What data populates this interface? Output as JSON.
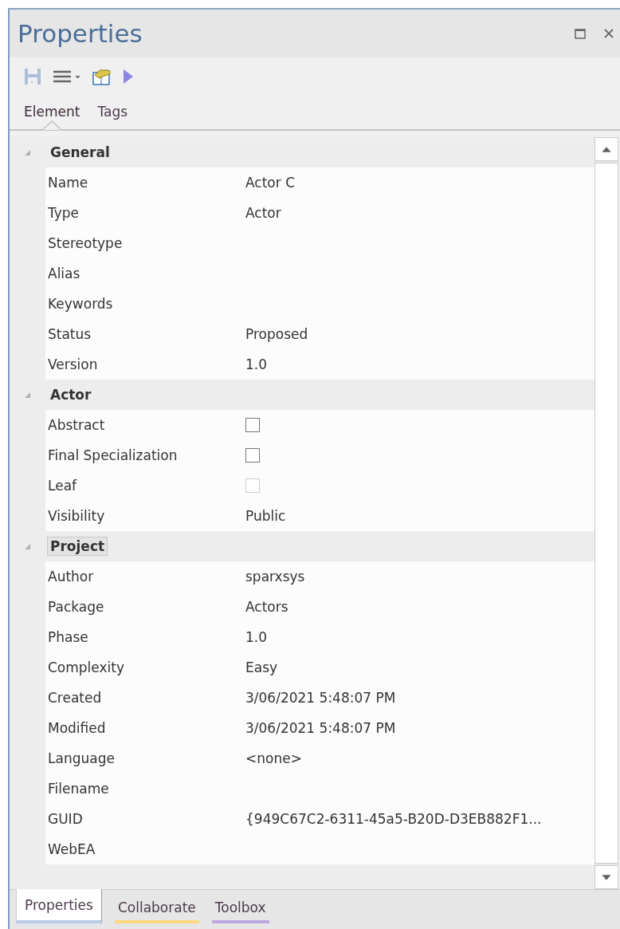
{
  "window": {
    "title": "Properties"
  },
  "tabs": [
    {
      "label": "Element",
      "selected": true
    },
    {
      "label": "Tags",
      "selected": false
    }
  ],
  "groups": [
    {
      "title": "General",
      "expanded": true,
      "focused": false,
      "rows": [
        {
          "kind": "text",
          "name": "Name",
          "value": "Actor C"
        },
        {
          "kind": "text",
          "name": "Type",
          "value": "Actor"
        },
        {
          "kind": "text",
          "name": "Stereotype",
          "value": ""
        },
        {
          "kind": "text",
          "name": "Alias",
          "value": ""
        },
        {
          "kind": "text",
          "name": "Keywords",
          "value": ""
        },
        {
          "kind": "text",
          "name": "Status",
          "value": "Proposed"
        },
        {
          "kind": "text",
          "name": "Version",
          "value": "1.0"
        }
      ]
    },
    {
      "title": "Actor",
      "expanded": true,
      "focused": false,
      "rows": [
        {
          "kind": "checkbox",
          "name": "Abstract",
          "checked": false,
          "disabled": false
        },
        {
          "kind": "checkbox",
          "name": "Final Specialization",
          "checked": false,
          "disabled": false
        },
        {
          "kind": "checkbox",
          "name": "Leaf",
          "checked": false,
          "disabled": true
        },
        {
          "kind": "text",
          "name": "Visibility",
          "value": "Public"
        }
      ]
    },
    {
      "title": "Project",
      "expanded": true,
      "focused": true,
      "rows": [
        {
          "kind": "text",
          "name": "Author",
          "value": "sparxsys"
        },
        {
          "kind": "text",
          "name": "Package",
          "value": "Actors"
        },
        {
          "kind": "text",
          "name": "Phase",
          "value": "1.0"
        },
        {
          "kind": "text",
          "name": "Complexity",
          "value": "Easy"
        },
        {
          "kind": "text",
          "name": "Created",
          "value": "3/06/2021 5:48:07 PM"
        },
        {
          "kind": "text",
          "name": "Modified",
          "value": "3/06/2021 5:48:07 PM"
        },
        {
          "kind": "text",
          "name": "Language",
          "value": "<none>"
        },
        {
          "kind": "text",
          "name": "Filename",
          "value": ""
        },
        {
          "kind": "text",
          "name": "GUID",
          "value": "{949C67C2-6311-45a5-B20D-D3EB882F1..."
        },
        {
          "kind": "text",
          "name": "WebEA",
          "value": ""
        }
      ]
    }
  ],
  "bottom_tabs": [
    {
      "label": "Properties",
      "selected": true,
      "color": "#b8cce8"
    },
    {
      "label": "Collaborate",
      "selected": false,
      "color": "#fcd97a"
    },
    {
      "label": "Toolbox",
      "selected": false,
      "color": "#bda6e0"
    }
  ]
}
